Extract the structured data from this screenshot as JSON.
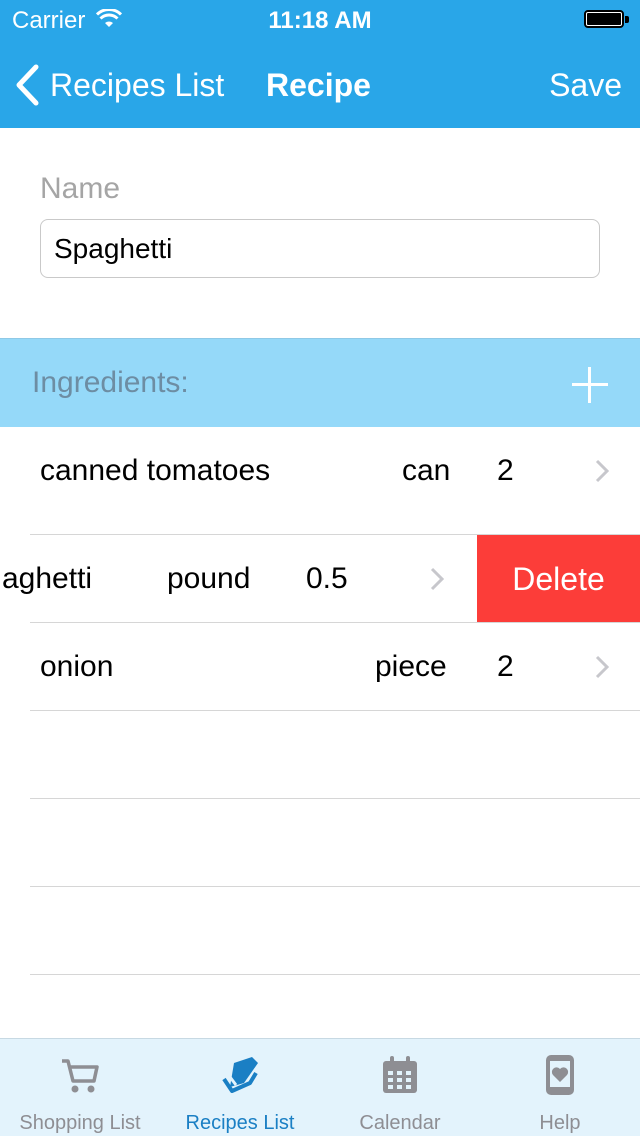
{
  "status_bar": {
    "carrier": "Carrier",
    "time": "11:18 AM"
  },
  "nav": {
    "back_label": "Recipes List",
    "title": "Recipe",
    "save_label": "Save"
  },
  "name_section": {
    "label": "Name",
    "value": "Spaghetti"
  },
  "ingredients": {
    "title": "Ingredients:",
    "rows": [
      {
        "name": "canned tomatoes",
        "unit": "can",
        "quantity": "2"
      },
      {
        "name": "aghetti",
        "unit": "pound",
        "quantity": "0.5",
        "swiped": true,
        "action_label": "Delete"
      },
      {
        "name": "onion",
        "unit": "piece",
        "quantity": "2"
      }
    ]
  },
  "tabbar": {
    "tabs": [
      {
        "label": "Shopping List",
        "icon": "cart-icon",
        "active": false
      },
      {
        "label": "Recipes List",
        "icon": "recipe-book-icon",
        "active": true
      },
      {
        "label": "Calendar",
        "icon": "calendar-icon",
        "active": false
      },
      {
        "label": "Help",
        "icon": "phone-heart-icon",
        "active": false
      }
    ]
  },
  "colors": {
    "nav_background": "#29a6e8",
    "section_header": "#95d9f9",
    "delete": "#fc3d39",
    "tab_active": "#1a7fc4",
    "tab_inactive": "#8e8e93"
  }
}
